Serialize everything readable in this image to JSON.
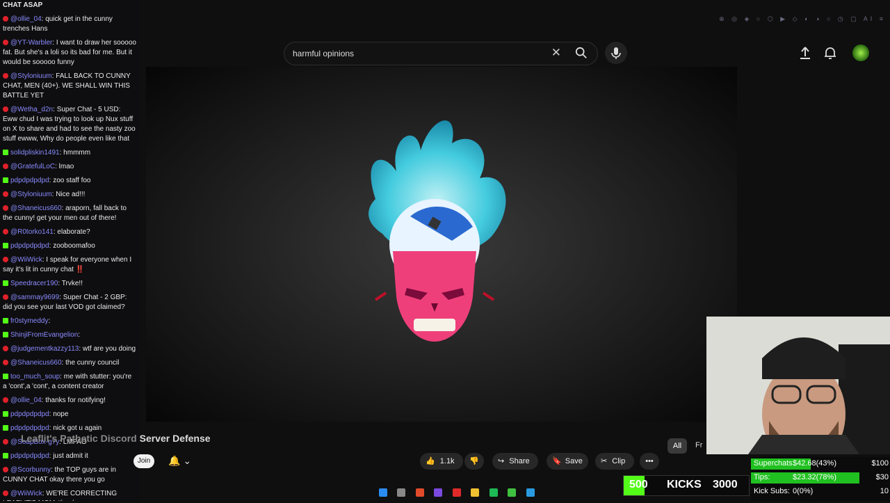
{
  "chat": {
    "messages": [
      {
        "source": "youtube",
        "user": "",
        "text": "CHAT ASAP"
      },
      {
        "source": "youtube",
        "user": "@ollie_04",
        "text": "quick get in the cunny trenches Hans"
      },
      {
        "source": "youtube",
        "user": "@YT-Warbler",
        "text": "I want to draw her sooooo fat. But she's a loli so its bad for me. But it would be sooooo funny"
      },
      {
        "source": "youtube",
        "user": "@Styloniuum",
        "text": "FALL BACK TO CUNNY CHAT, MEN (40+). WE SHALL WIN THIS BATTLE YET"
      },
      {
        "source": "youtube",
        "user": "@Wetha_d2n",
        "text": "Super Chat - 5 USD: Eww chud I was trying to look up Nux stuff on X to share and had to see the nasty zoo stuff ewww, Why do people even like that"
      },
      {
        "source": "kick",
        "user": "solidpliskin1491",
        "text": "hmmmm"
      },
      {
        "source": "youtube",
        "user": "@GratefulLoC",
        "text": "lmao"
      },
      {
        "source": "kick",
        "user": "pdpdpdpdpd",
        "text": "zoo staff foo"
      },
      {
        "source": "youtube",
        "user": "@Styloniuum",
        "text": "Nice ad!!!"
      },
      {
        "source": "youtube",
        "user": "@Shaneicus660",
        "text": "araporn, fall back to the cunny! get your men out of there!"
      },
      {
        "source": "youtube",
        "user": "@R0torko141",
        "text": "elaborate?"
      },
      {
        "source": "kick",
        "user": "pdpdpdpdpd",
        "text": "zooboomafoo"
      },
      {
        "source": "youtube",
        "user": "@WiiWick",
        "text": "I speak for everyone when I say it's lit in cunny chat ‼️"
      },
      {
        "source": "kick",
        "user": "Speedracer190",
        "text": "Trvke!!"
      },
      {
        "source": "youtube",
        "user": "@sammay9699",
        "text": "Super Chat - 2 GBP: did you see your last VOD got claimed?"
      },
      {
        "source": "kick",
        "user": "fr0stymeddy",
        "text": ""
      },
      {
        "source": "kick",
        "user": "ShinjiFromEvangelion",
        "text": ""
      },
      {
        "source": "youtube",
        "user": "@judgementkazzy113",
        "text": "wtf are you doing"
      },
      {
        "source": "youtube",
        "user": "@Shaneicus660",
        "text": "the cunny council"
      },
      {
        "source": "kick",
        "user": "too_much_soup",
        "text": "me with stutter: you're a 'cont',a 'cont', a content creator"
      },
      {
        "source": "youtube",
        "user": "@ollie_04",
        "text": "thanks for notifying!"
      },
      {
        "source": "kick",
        "user": "pdpdpdpdpd",
        "text": "nope"
      },
      {
        "source": "kick",
        "user": "pdpdpdpdpd",
        "text": "nick got u again"
      },
      {
        "source": "youtube",
        "user": "@SoapBox-g7y",
        "text": "LMFAO"
      },
      {
        "source": "kick",
        "user": "pdpdpdpdpd",
        "text": "just admit it"
      },
      {
        "source": "youtube",
        "user": "@Scorbunny",
        "text": "the TOP guys are in CUNNY CHAT okay there you go"
      },
      {
        "source": "youtube",
        "user": "@WiiWick",
        "text": "WE'RE CORRECTING LEAFLIT'S MOM #haglove"
      }
    ]
  },
  "search": {
    "query": "harmful opinions"
  },
  "video": {
    "title": "Server Defense",
    "channel": "Leaflit's Pathetic Discord",
    "join_label": "Join",
    "likes": "1.1k",
    "share_label": "Share",
    "save_label": "Save",
    "clip_label": "Clip"
  },
  "tabs": {
    "all": "All",
    "next": "Fr"
  },
  "kicks": {
    "current": "500",
    "label": "KICKS",
    "goal": "3000",
    "progress": 0.1667
  },
  "stats": {
    "superchats": {
      "label": "Superchats",
      "value": "$42.68(43%)",
      "goal": "$100",
      "progress": 0.43
    },
    "tips": {
      "label": "Tips:",
      "value": "$23.32(78%)",
      "goal": "$30",
      "progress": 0.78
    },
    "kick_subs": {
      "label": "Kick Subs:",
      "value": "0(0%)",
      "goal": "10",
      "progress": 0.0
    }
  },
  "colors": {
    "accent": "#53fc18",
    "youtube": "#e0202a",
    "background": "#0f0f0f"
  }
}
